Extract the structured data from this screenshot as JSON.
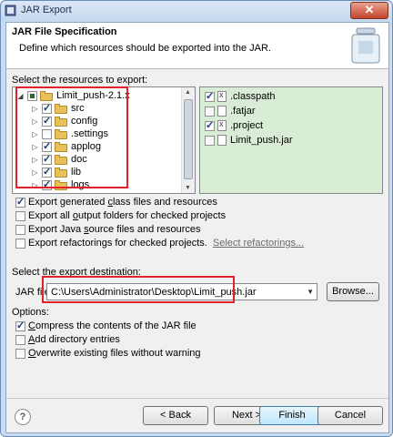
{
  "window": {
    "title": "JAR Export",
    "close_label": "✕"
  },
  "banner": {
    "heading": "JAR File Specification",
    "description": "Define which resources should be exported into the JAR."
  },
  "resources": {
    "label": "Select the resources to export:",
    "tree": [
      {
        "label": "Limit_push-2.1.x",
        "expanded": true,
        "state": "partial",
        "icon": "project-icon"
      },
      {
        "label": "src",
        "state": "checked",
        "icon": "package-folder-icon"
      },
      {
        "label": "config",
        "state": "checked",
        "icon": "package-folder-icon"
      },
      {
        "label": ".settings",
        "state": "unchecked",
        "icon": "folder-icon"
      },
      {
        "label": "applog",
        "state": "checked",
        "icon": "folder-icon"
      },
      {
        "label": "doc",
        "state": "checked",
        "icon": "folder-icon"
      },
      {
        "label": "lib",
        "state": "checked",
        "icon": "folder-icon"
      },
      {
        "label": "logs",
        "state": "checked",
        "icon": "folder-icon"
      }
    ],
    "files": [
      {
        "label": ".classpath",
        "state": "checked",
        "icon": "xml-file-icon"
      },
      {
        "label": ".fatjar",
        "state": "unchecked",
        "icon": "file-icon"
      },
      {
        "label": ".project",
        "state": "checked",
        "icon": "xml-file-icon"
      },
      {
        "label": "Limit_push.jar",
        "state": "unchecked",
        "icon": "jar-file-icon"
      }
    ]
  },
  "export_options": [
    {
      "pre": "Export generated ",
      "u": "c",
      "post": "lass files and resources",
      "checked": true
    },
    {
      "pre": "Export all ",
      "u": "o",
      "post": "utput folders for checked projects",
      "checked": false
    },
    {
      "pre": "Export Java ",
      "u": "s",
      "post": "ource files and resources",
      "checked": false
    },
    {
      "pre": "Export refactorings for checked projects. ",
      "u": "",
      "post": "",
      "checked": false
    }
  ],
  "refactorings_link": "Select refactorings...",
  "destination": {
    "label": "Select the export destination:",
    "field_label": "JAR file:",
    "value": "C:\\Users\\Administrator\\Desktop\\Limit_push.jar",
    "browse_label": "Browse..."
  },
  "options": {
    "label": "Options:",
    "items": [
      {
        "pre": "",
        "u": "C",
        "post": "ompress the contents of the JAR file",
        "checked": true
      },
      {
        "pre": "",
        "u": "A",
        "post": "dd directory entries",
        "checked": false
      },
      {
        "pre": "",
        "u": "O",
        "post": "verwrite existing files without warning",
        "checked": false
      }
    ]
  },
  "buttons": {
    "help": "?",
    "back": "< Back",
    "next": "Next >",
    "finish": "Finish",
    "cancel": "Cancel"
  },
  "colors": {
    "annotation_red": "#e0202a",
    "selected_panel_bg": "#d9ecd5"
  }
}
